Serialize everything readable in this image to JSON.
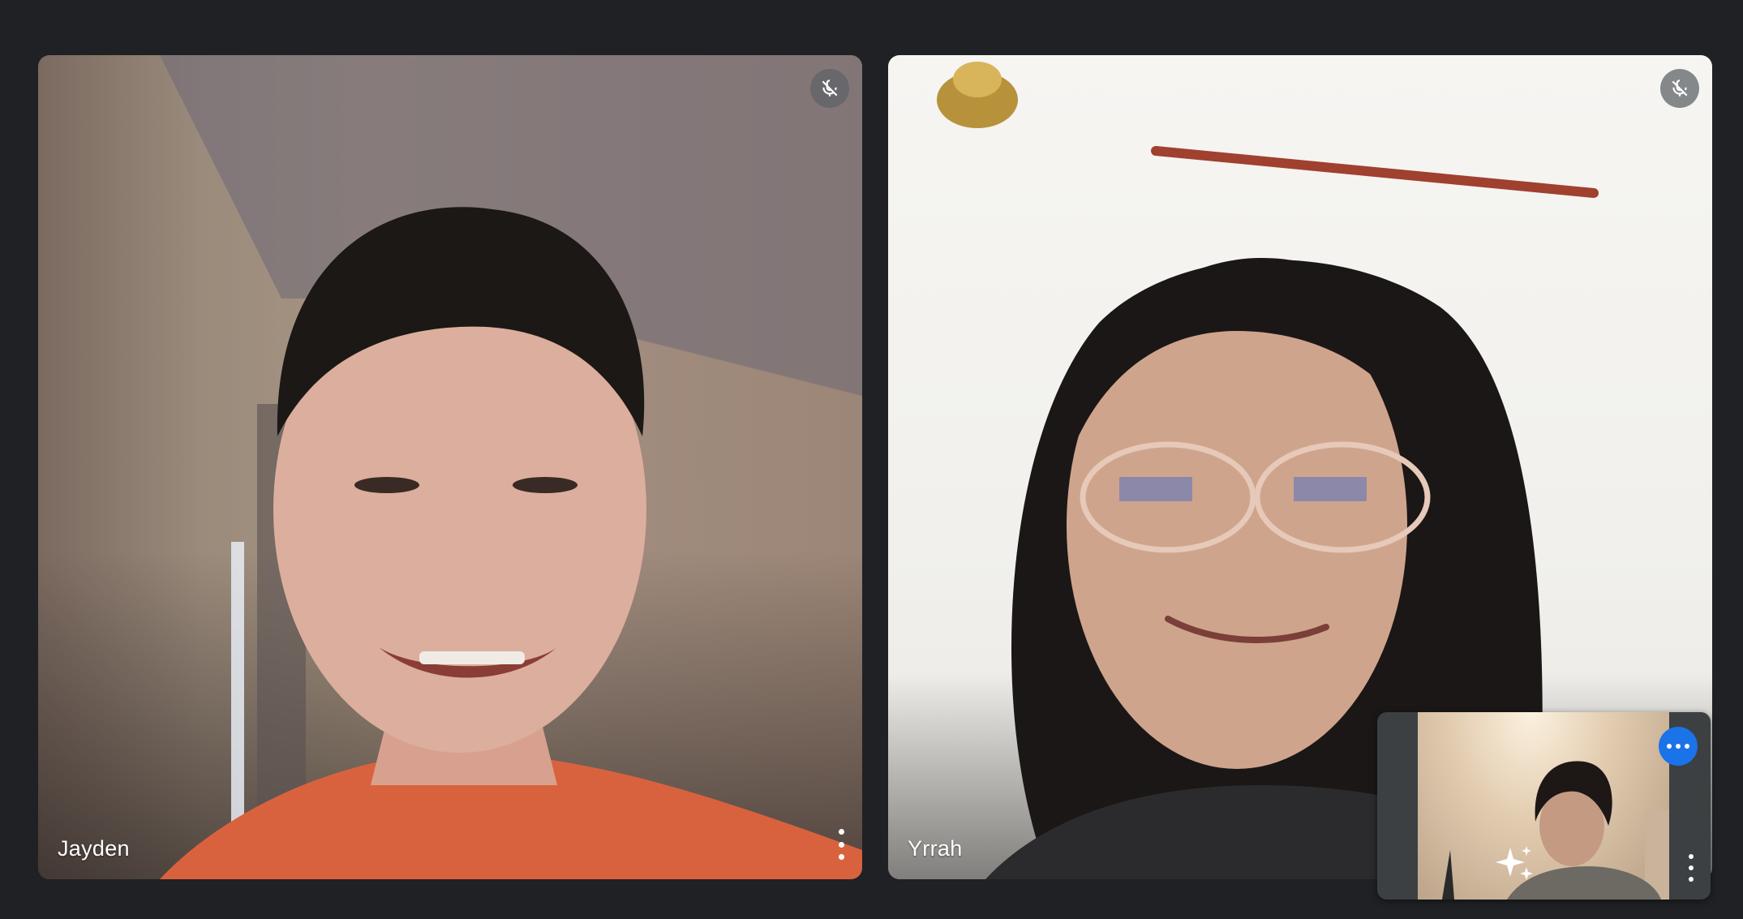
{
  "participants": [
    {
      "name": "Jayden",
      "muted": true
    },
    {
      "name": "Yrrah",
      "muted": true
    }
  ],
  "self_view": {
    "more_options": "more-options-icon",
    "effects": "sparkle-effects-icon"
  },
  "icons": {
    "mute": "mic-off-icon",
    "menu": "more-vert-icon"
  },
  "colors": {
    "background": "#202124",
    "accent": "#1a73e8",
    "badge": "#5f6368"
  }
}
